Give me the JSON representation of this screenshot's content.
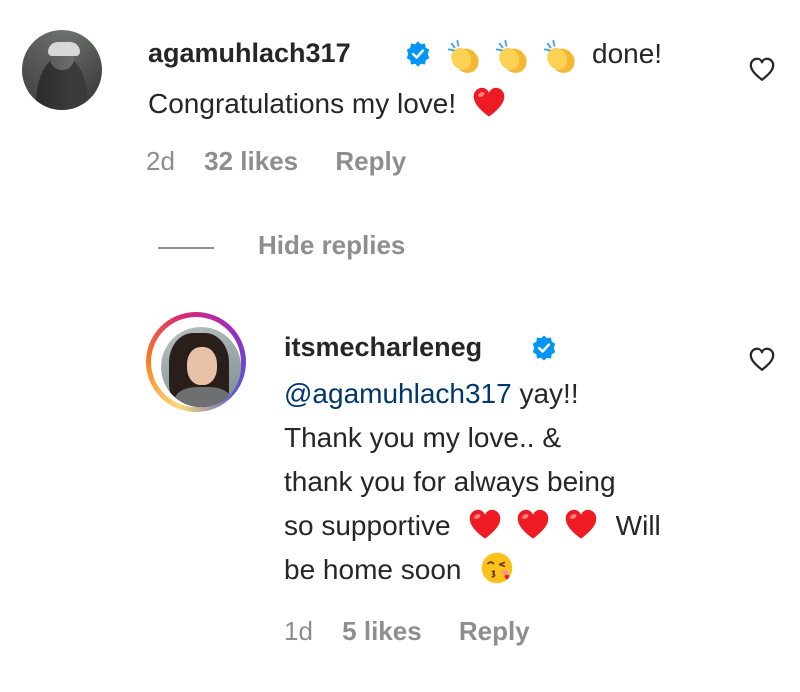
{
  "comment": {
    "username": "agamuhlach317",
    "verified": true,
    "text_suffix": "done!",
    "text_line2": "Congratulations my love!",
    "time": "2d",
    "likes": "32 likes",
    "reply_label": "Reply",
    "emojis": [
      "clapping-hands",
      "clapping-hands",
      "clapping-hands",
      "red-heart"
    ]
  },
  "replies_toggle": {
    "label": "Hide replies"
  },
  "reply": {
    "username": "itsmecharleneg",
    "verified": true,
    "mention": "@agamuhlach317",
    "line1_rest": "yay!!",
    "line2": "Thank you my love.. &",
    "line3": "thank you for always being",
    "line4_start": "so supportive",
    "line4_end": "Will",
    "line5": "be home soon",
    "time": "1d",
    "likes": "5 likes",
    "reply_label": "Reply",
    "emojis": [
      "red-heart",
      "red-heart",
      "red-heart",
      "face-blowing-kiss"
    ]
  },
  "colors": {
    "text": "#262626",
    "secondary": "#8e8e8e",
    "mention": "#00376b",
    "verified": "#0095f6",
    "heart": "#ed1c24"
  }
}
